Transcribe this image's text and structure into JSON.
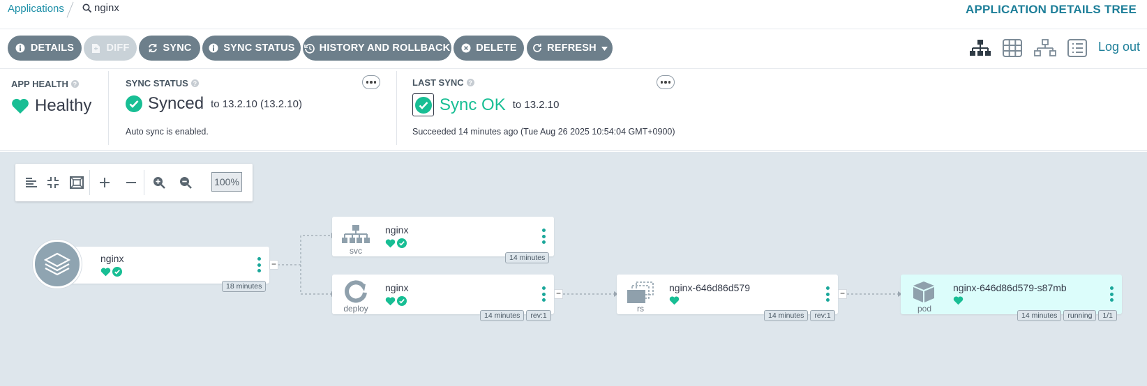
{
  "breadcrumb": {
    "applications": "Applications",
    "search": "nginx"
  },
  "page_title": "APPLICATION DETAILS TREE",
  "toolbar": {
    "details": "DETAILS",
    "diff": "DIFF",
    "sync": "SYNC",
    "sync_status": "SYNC STATUS",
    "history": "HISTORY AND ROLLBACK",
    "delete": "DELETE",
    "refresh": "REFRESH"
  },
  "views": {
    "logout": "Log out"
  },
  "app_health": {
    "label": "APP HEALTH",
    "value": "Healthy"
  },
  "sync_status": {
    "label": "SYNC STATUS",
    "value": "Synced",
    "target": "to 13.2.10 (13.2.10)",
    "note": "Auto sync is enabled."
  },
  "last_sync": {
    "label": "LAST SYNC",
    "value": "Sync OK",
    "target": "to 13.2.10",
    "note": "Succeeded 14 minutes ago (Tue Aug 26 2025 10:54:04 GMT+0900)"
  },
  "graph_tools": {
    "zoom": "100%"
  },
  "colors": {
    "healthy": "#18be94",
    "accent": "#1e7f99",
    "button": "#6d7f8b",
    "canvas": "#dee6ec"
  },
  "nodes": {
    "app": {
      "name": "nginx",
      "age": "18 minutes"
    },
    "svc": {
      "name": "nginx",
      "kind": "svc",
      "age": "14 minutes"
    },
    "deploy": {
      "name": "nginx",
      "kind": "deploy",
      "age": "14 minutes",
      "rev": "rev:1"
    },
    "rs": {
      "name": "nginx-646d86d579",
      "kind": "rs",
      "age": "14 minutes",
      "rev": "rev:1"
    },
    "pod": {
      "name": "nginx-646d86d579-s87mb",
      "kind": "pod",
      "age": "14 minutes",
      "state": "running",
      "ready": "1/1"
    }
  }
}
